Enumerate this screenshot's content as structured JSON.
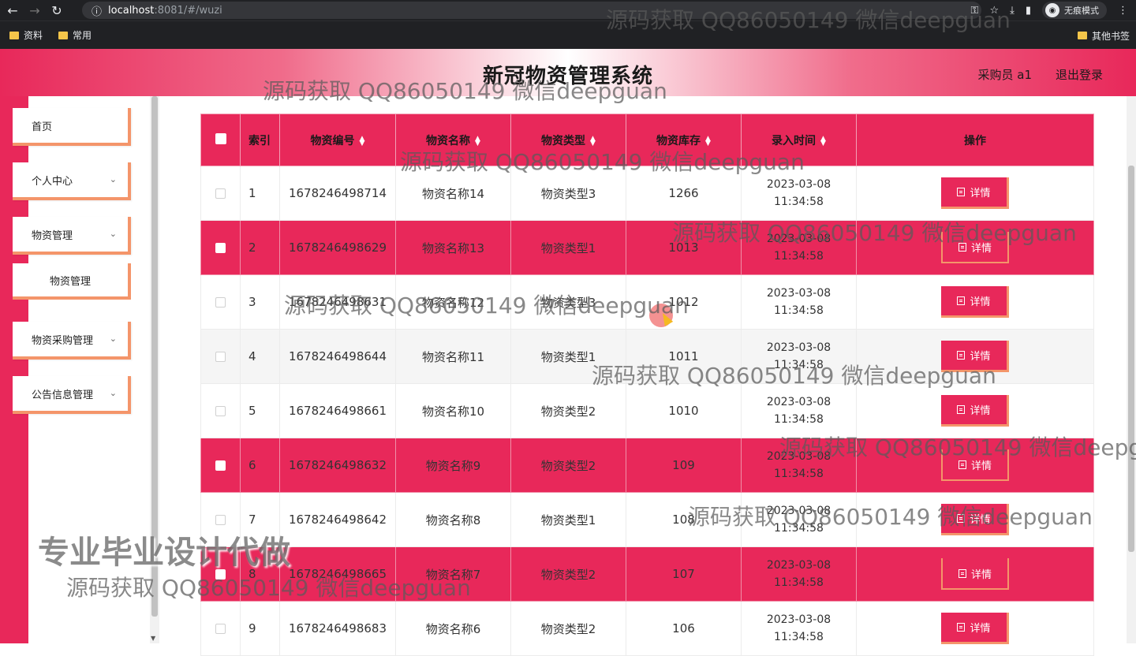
{
  "browser": {
    "url_host": "localhost",
    "url_rest": ":8081/#/wuzi",
    "incognito_label": "无痕模式",
    "bookmarks": [
      "资料",
      "常用"
    ],
    "other_bookmarks": "其他书签"
  },
  "header": {
    "title": "新冠物资管理系统",
    "user": "采购员 a1",
    "logout": "退出登录"
  },
  "sidebar": {
    "items": [
      {
        "label": "首页"
      },
      {
        "label": "个人中心"
      },
      {
        "label": "物资管理"
      },
      {
        "label": "物资管理"
      },
      {
        "label": "物资采购管理"
      },
      {
        "label": "公告信息管理"
      }
    ]
  },
  "table": {
    "headers": {
      "index": "索引",
      "code": "物资编号",
      "name": "物资名称",
      "type": "物资类型",
      "stock": "物资库存",
      "time": "录入时间",
      "action": "操作"
    },
    "detail_label": "详情",
    "rows": [
      {
        "index": "1",
        "code": "1678246498714",
        "name": "物资名称14",
        "type": "物资类型3",
        "stock": "1266",
        "time": "2023-03-08 11:34:58"
      },
      {
        "index": "2",
        "code": "1678246498629",
        "name": "物资名称13",
        "type": "物资类型1",
        "stock": "1013",
        "time": "2023-03-08 11:34:58"
      },
      {
        "index": "3",
        "code": "1678246498631",
        "name": "物资名称12",
        "type": "物资类型3",
        "stock": "1012",
        "time": "2023-03-08 11:34:58"
      },
      {
        "index": "4",
        "code": "1678246498644",
        "name": "物资名称11",
        "type": "物资类型1",
        "stock": "1011",
        "time": "2023-03-08 11:34:58"
      },
      {
        "index": "5",
        "code": "1678246498661",
        "name": "物资名称10",
        "type": "物资类型2",
        "stock": "1010",
        "time": "2023-03-08 11:34:58"
      },
      {
        "index": "6",
        "code": "1678246498632",
        "name": "物资名称9",
        "type": "物资类型2",
        "stock": "109",
        "time": "2023-03-08 11:34:58"
      },
      {
        "index": "7",
        "code": "1678246498642",
        "name": "物资名称8",
        "type": "物资类型1",
        "stock": "108",
        "time": "2023-03-08 11:34:58"
      },
      {
        "index": "8",
        "code": "1678246498665",
        "name": "物资名称7",
        "type": "物资类型2",
        "stock": "107",
        "time": "2023-03-08 11:34:58"
      },
      {
        "index": "9",
        "code": "1678246498683",
        "name": "物资名称6",
        "type": "物资类型2",
        "stock": "106",
        "time": "2023-03-08 11:34:58"
      }
    ]
  },
  "watermarks": {
    "text": "源码获取 QQ86050149 微信deepguan",
    "big": "专业毕业设计代做"
  },
  "colors": {
    "accent": "#e8285a",
    "border_accent": "#f4956a"
  }
}
